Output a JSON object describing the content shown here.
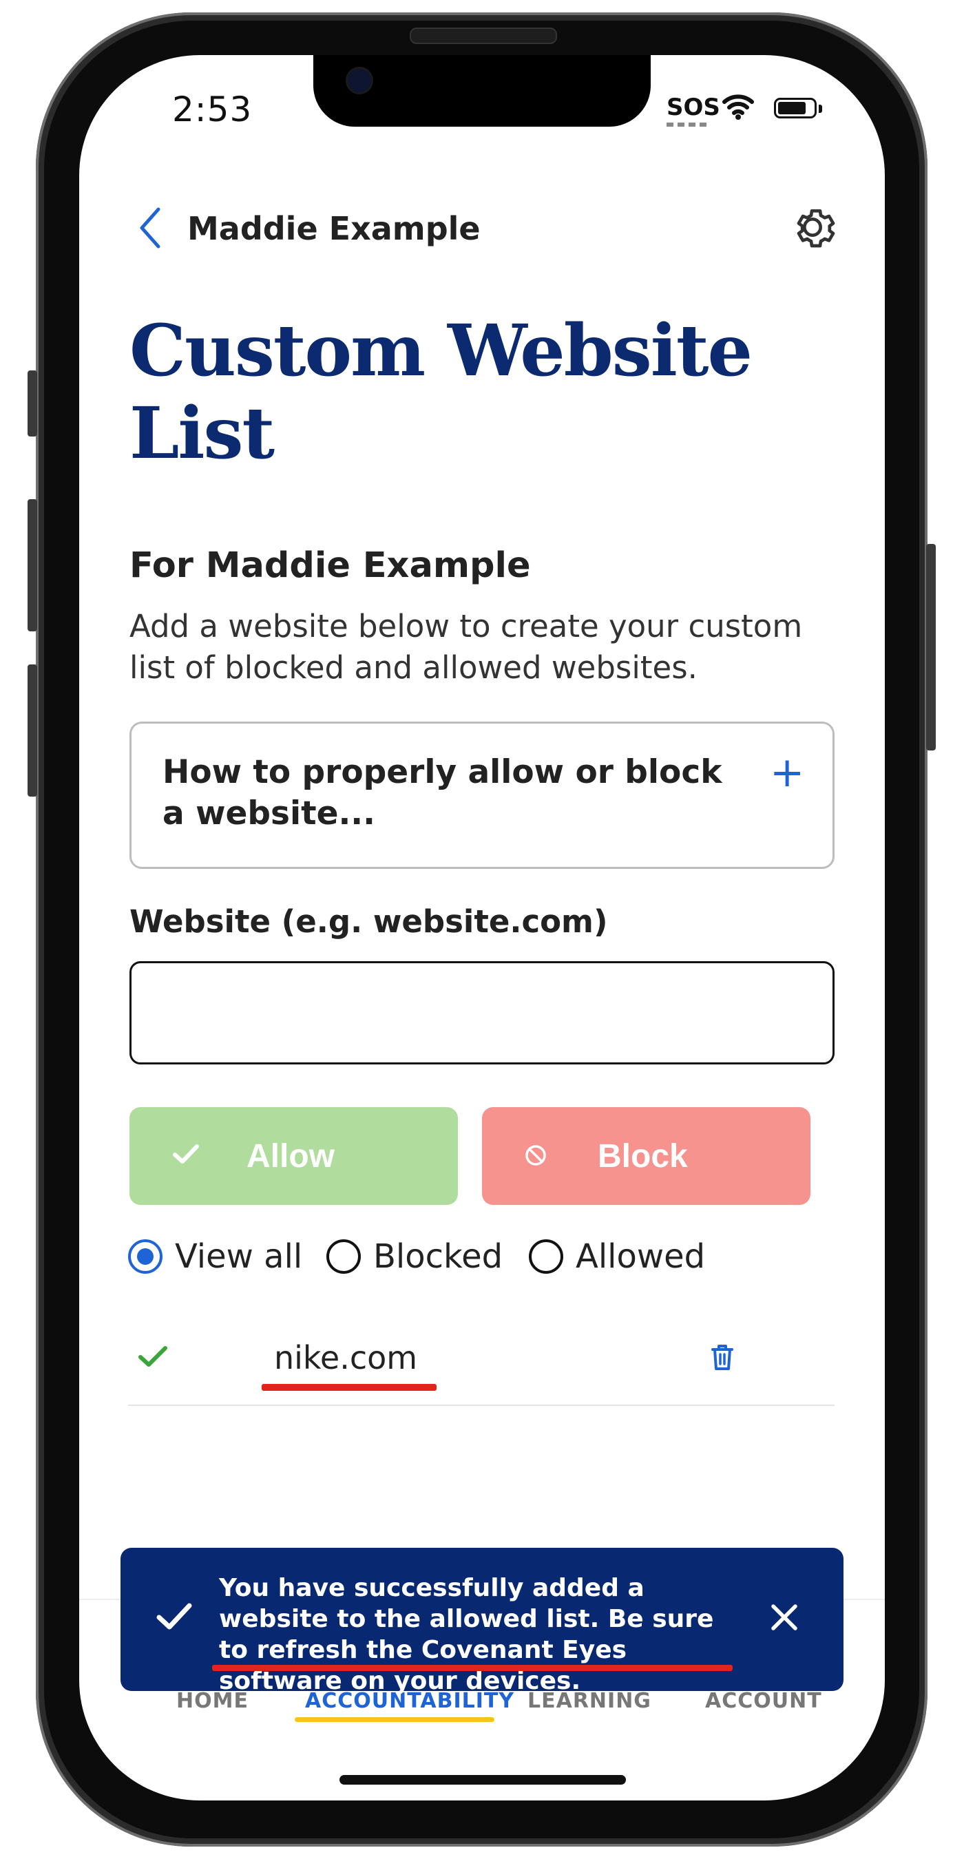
{
  "status_bar": {
    "time": "2:53",
    "sos": "SOS"
  },
  "nav": {
    "back_label": "Maddie Example"
  },
  "page_title": "Custom Website List",
  "section": {
    "heading": "For Maddie Example",
    "description": "Add a website below to create your custom list of blocked and allowed websites."
  },
  "accordion": {
    "label": "How to properly allow or block a website...",
    "expand_symbol": "+"
  },
  "website_field": {
    "label": "Website (e.g. website.com)",
    "value": "",
    "placeholder": ""
  },
  "actions": {
    "allow_label": "Allow",
    "block_label": "Block"
  },
  "filters": [
    {
      "label": "View all",
      "selected": true
    },
    {
      "label": "Blocked",
      "selected": false
    },
    {
      "label": "Allowed",
      "selected": false
    }
  ],
  "websites": [
    {
      "domain": "nike.com",
      "status": "allowed"
    }
  ],
  "toast": {
    "message": "You have successfully added a website to the allowed list. Be sure to refresh the Covenant Eyes software on your devices."
  },
  "tabs": [
    {
      "label": "HOME",
      "active": false
    },
    {
      "label": "ACCOUNTABILITY",
      "active": true
    },
    {
      "label": "LEARNING",
      "active": false
    },
    {
      "label": "ACCOUNT",
      "active": false
    }
  ],
  "colors": {
    "title_navy": "#0b2a6f",
    "accent_blue": "#1f64d6",
    "allow_green": "#b0dc9e",
    "block_red": "#f7938f",
    "toast_bg": "#082872",
    "tab_highlight": "#f5c518",
    "annotation_red": "#e5231b",
    "check_green": "#3aa63a"
  },
  "icons": {
    "back": "chevron-left-icon",
    "settings": "gear-icon",
    "allow": "check-icon",
    "block": "prohibited-icon",
    "delete": "trash-icon",
    "toast_check": "check-icon",
    "toast_close": "close-icon"
  }
}
